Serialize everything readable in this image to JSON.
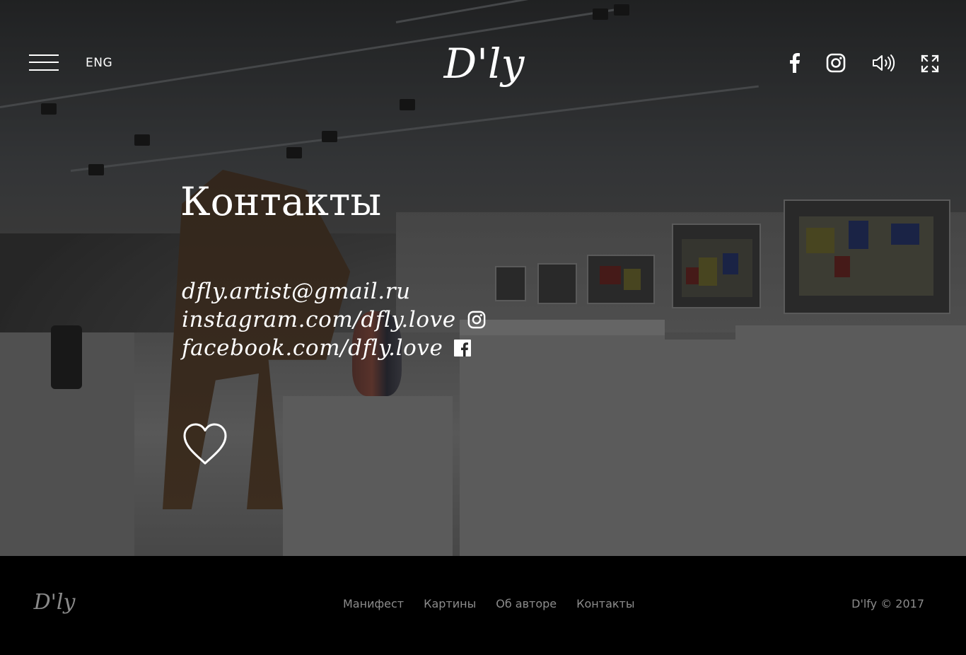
{
  "header": {
    "language_label": "ENG",
    "logo_text": "D'ly",
    "icons": [
      "menu-icon",
      "facebook-icon",
      "instagram-icon",
      "sound-icon",
      "fullscreen-icon"
    ]
  },
  "main": {
    "title": "Контакты",
    "contacts": {
      "email": "dfly.artist@gmail.ru",
      "instagram": "instagram.com/dfly.love",
      "facebook": "facebook.com/dfly.love"
    },
    "heart_icon": "heart-icon"
  },
  "footer": {
    "logo_text": "D'ly",
    "nav": [
      {
        "label": "Манифест"
      },
      {
        "label": "Картины"
      },
      {
        "label": "Об авторе"
      },
      {
        "label": "Контакты"
      }
    ],
    "copyright": "D'lfy © 2017"
  },
  "colors": {
    "text": "#ffffff",
    "footer_background": "#000000",
    "footer_text": "#8c8c8c"
  }
}
